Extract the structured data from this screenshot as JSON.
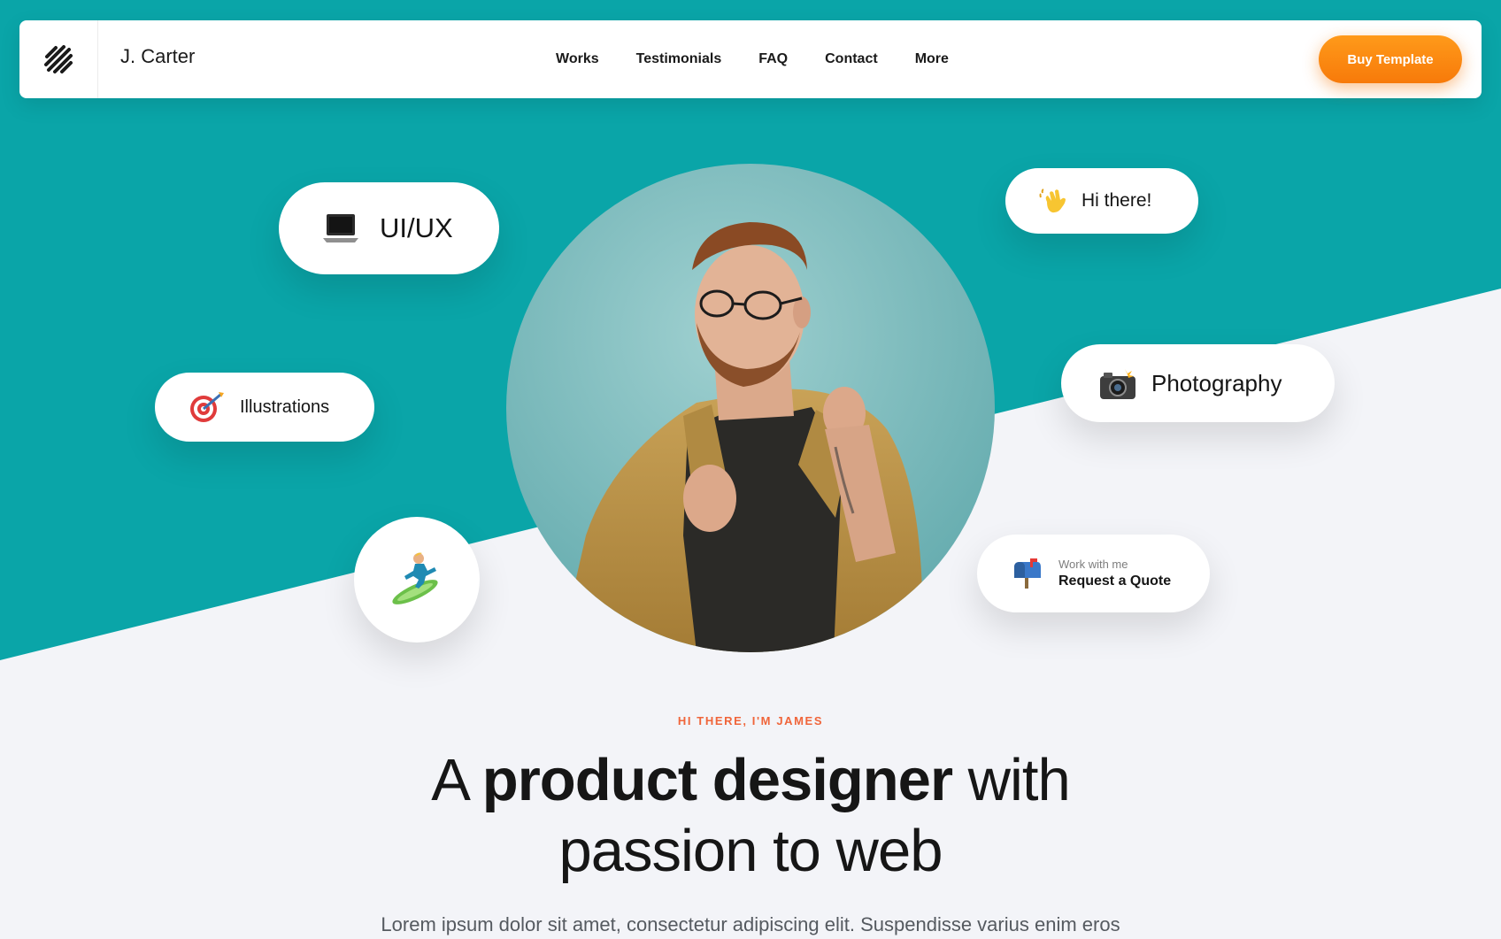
{
  "colors": {
    "teal": "#0aa5a8",
    "background": "#f3f4f8",
    "accent_orange": "#f77a0a",
    "eyebrow": "#f0653a"
  },
  "navbar": {
    "logo_icon": "diagonal-stripes-logo",
    "brand": "J. Carter",
    "links": [
      "Works",
      "Testimonials",
      "FAQ",
      "Contact",
      "More"
    ],
    "cta_label": "Buy Template"
  },
  "hero": {
    "portrait_icon": "man-with-glasses-portrait-photo",
    "tags": {
      "uiux": {
        "icon": "laptop-icon",
        "label": "UI/UX"
      },
      "illustrations": {
        "icon": "target-icon",
        "label": "Illustrations"
      },
      "hi": {
        "icon": "waving-hand-icon",
        "label": "Hi there!"
      },
      "photography": {
        "icon": "camera-flash-icon",
        "label": "Photography"
      },
      "quote": {
        "icon": "mailbox-icon",
        "sub": "Work with me",
        "label": "Request a Quote"
      },
      "surfer": {
        "icon": "surfer-icon"
      }
    },
    "eyebrow": "HI THERE, I'M JAMES",
    "headline": {
      "part1": "A ",
      "bold": "product designer",
      "part2": " with",
      "line2": "passion to web"
    },
    "lead": "Lorem ipsum dolor sit amet, consectetur adipiscing elit. Suspendisse varius enim eros"
  }
}
